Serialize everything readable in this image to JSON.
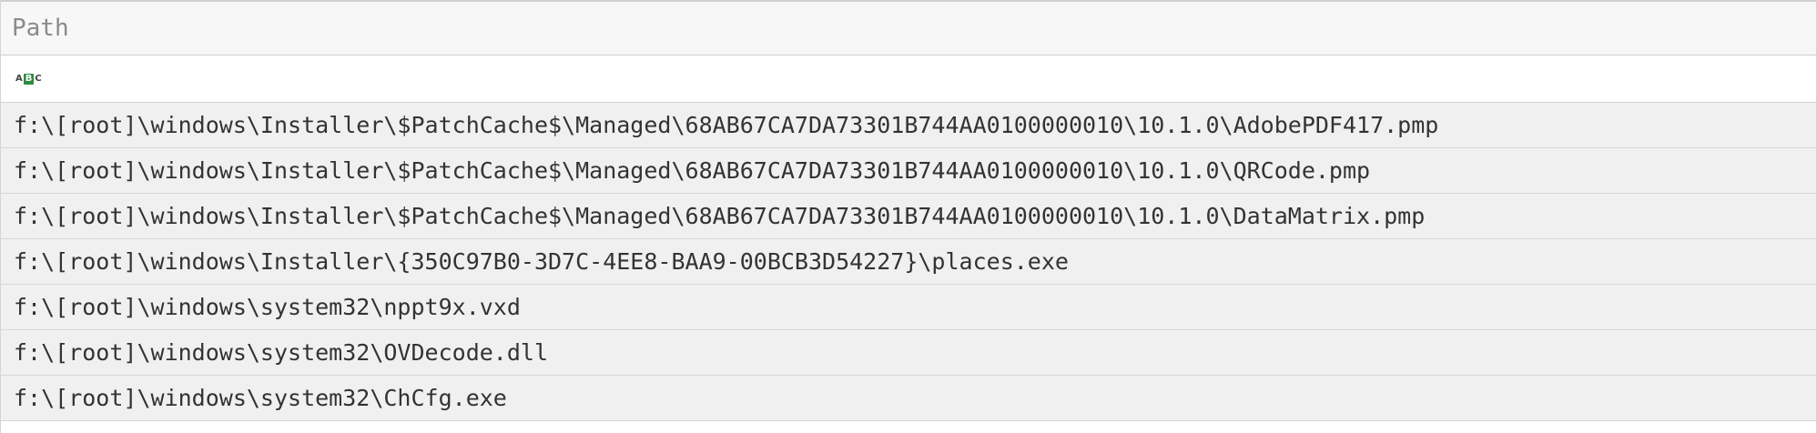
{
  "column": {
    "header_label": "Path",
    "filter_icon": "abc-text-filter-icon",
    "filter_icon_letters": [
      "A",
      "B",
      "C"
    ]
  },
  "rows": [
    {
      "path": "f:\\[root]\\windows\\Installer\\$PatchCache$\\Managed\\68AB67CA7DA73301B744AA0100000010\\10.1.0\\AdobePDF417.pmp"
    },
    {
      "path": "f:\\[root]\\windows\\Installer\\$PatchCache$\\Managed\\68AB67CA7DA73301B744AA0100000010\\10.1.0\\QRCode.pmp"
    },
    {
      "path": "f:\\[root]\\windows\\Installer\\$PatchCache$\\Managed\\68AB67CA7DA73301B744AA0100000010\\10.1.0\\DataMatrix.pmp"
    },
    {
      "path": "f:\\[root]\\windows\\Installer\\{350C97B0-3D7C-4EE8-BAA9-00BCB3D54227}\\places.exe"
    },
    {
      "path": "f:\\[root]\\windows\\system32\\nppt9x.vxd"
    },
    {
      "path": "f:\\[root]\\windows\\system32\\OVDecode.dll"
    },
    {
      "path": "f:\\[root]\\windows\\system32\\ChCfg.exe"
    }
  ],
  "colors": {
    "header_bg": "#f7f7f7",
    "row_bg": "#f0f0f0",
    "filter_icon_accent": "#2e8b3f"
  }
}
